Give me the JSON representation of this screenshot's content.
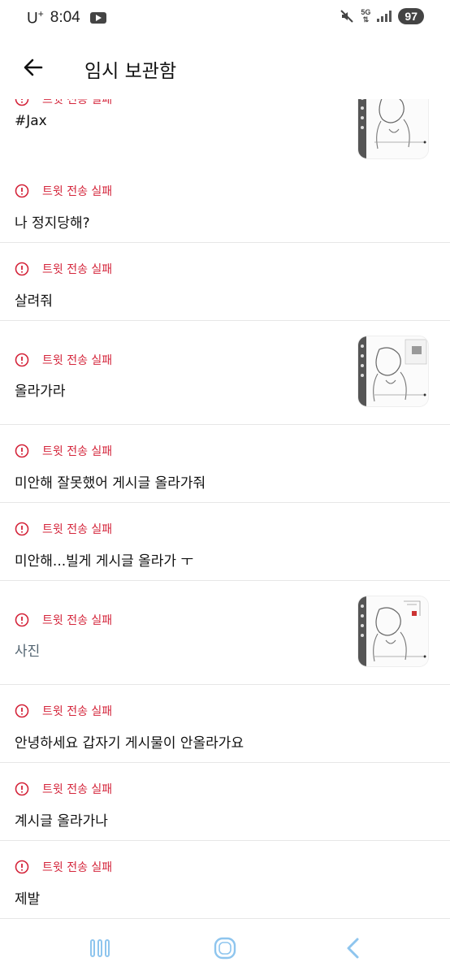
{
  "status_bar": {
    "carrier": "U",
    "carrier_sup": "+",
    "time": "8:04",
    "network": "5G",
    "battery": "97"
  },
  "header": {
    "title": "임시 보관함"
  },
  "drafts": [
    {
      "status": "트윗 전송 실패",
      "text": "#Jax",
      "has_image": true
    },
    {
      "status": "트윗 전송 실패",
      "text": "나 정지당해?",
      "has_image": false
    },
    {
      "status": "트윗 전송 실패",
      "text": "살려줘",
      "has_image": false
    },
    {
      "status": "트윗 전송 실패",
      "text": "올라가라",
      "has_image": true
    },
    {
      "status": "트윗 전송 실패",
      "text": "미안해 잘못했어 게시글 올라가줘",
      "has_image": false
    },
    {
      "status": "트윗 전송 실패",
      "text": "미안해...빌게 게시글 올라가 ㅜ",
      "has_image": false
    },
    {
      "status": "트윗 전송 실패",
      "text": "사진",
      "has_image": true
    },
    {
      "status": "트윗 전송 실패",
      "text": "안녕하세요 갑자기 게시물이 안올라가요",
      "has_image": false
    },
    {
      "status": "트윗 전송 실패",
      "text": "계시글 올라가나",
      "has_image": false
    },
    {
      "status": "트윗 전송 실패",
      "text": "제발",
      "has_image": false
    }
  ],
  "colors": {
    "error": "#d4243a",
    "divider": "#e6e6e6",
    "nav_icon": "#8ec5ee"
  },
  "icons": {
    "back": "arrow-left-icon",
    "alert": "alert-circle-icon",
    "recents": "recents-icon",
    "home": "home-icon",
    "nav_back": "chevron-left-icon"
  }
}
